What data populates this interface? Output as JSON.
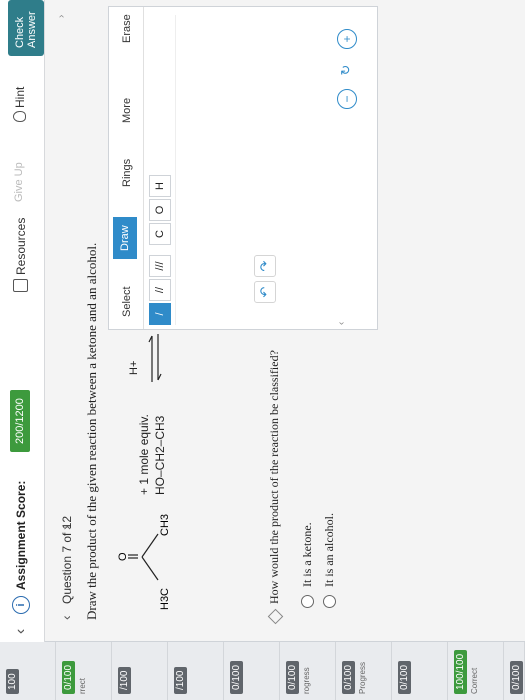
{
  "sidebar": {
    "items": [
      {
        "score": "100",
        "status": "",
        "green": false
      },
      {
        "score": "0/100",
        "status": "rrect",
        "green": true
      },
      {
        "score": "/100",
        "status": "",
        "green": false
      },
      {
        "score": "/100",
        "status": "",
        "green": false
      },
      {
        "score": "0/100",
        "status": "",
        "green": false
      },
      {
        "score": "0/100",
        "status": "rogress",
        "green": false
      },
      {
        "score": "0/100",
        "status": "Progress",
        "green": false
      },
      {
        "score": "0/100",
        "status": "",
        "green": false
      },
      {
        "score": "100/100",
        "status": "Correct",
        "green": true
      },
      {
        "score": "0/100",
        "status": "",
        "green": false
      }
    ]
  },
  "header": {
    "assignment_label": "Assignment Score:",
    "assignment_score": "200/1200",
    "resources_label": "Resources",
    "giveup_label": "Give Up",
    "hint_label": "Hint",
    "check_label": "Check Answer"
  },
  "question": {
    "label": "Question 7 of 12",
    "prompt": "Draw the product of the given reaction between a ketone and an alcohol."
  },
  "reaction": {
    "oxygen": "O",
    "left_methyl": "H3C",
    "right_methyl": "CH3",
    "reagent_line1": "+ 1 mole equiv.",
    "reagent_line2": "HO–CH2–CH3",
    "catalyst": "H+"
  },
  "sketcher": {
    "tabs": [
      "Select",
      "Draw",
      "Rings",
      "More",
      "Erase"
    ],
    "active_tab": "Draw",
    "tools": [
      "/",
      "//",
      "///",
      "C",
      "O",
      "H"
    ],
    "selected_tool": "/"
  },
  "classification": {
    "question": "How would the product of the reaction be classified?",
    "options": [
      "It is a ketone.",
      "It is an alcohol."
    ]
  }
}
